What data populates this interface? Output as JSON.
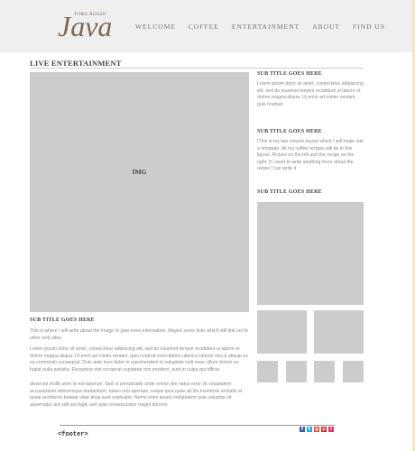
{
  "logo": {
    "tagline": "TORO ROSSO",
    "wordmark": "Java"
  },
  "nav": [
    "WELCOME",
    "COFFEE",
    "ENTERTAINMENT",
    "ABOUT",
    "FIND US"
  ],
  "page_title": "LIVE ENTERTAINMENT",
  "main_image_label": "IMG",
  "main_section": {
    "subtitle": "SUB TITLE GOES HERE",
    "intro": "This is where I will write about the image or give more information. Maybe some links which will link out to other web sites.",
    "para1": "Lorem ipsum dolor sit amet, consectetur adipiscing elit, sed do eiusmod tempor incididunt ut labore et dolore magna aliqua. Ut enim ad minim veniam, quis nostrud exercitation ullamco laboris nisi ut aliquip ex ea commodo consequat. Duis aute irure dolor in reprehenderit in voluptate velit esse cillum dolore eu fugiat nulla pariatur. Excepteur sint occaecat cupidatat non proident, sunt in culpa qui officia",
    "para2": "deserunt mollit anim id est laborum. Sed ut perspiciatis unde omnis iste natus error sit voluptatem accusantium doloremque laudantium, totam rem aperiam, eaque ipsa quae ab illo inventore veritatis et quasi architecto beatae vitae dicta sunt explicabo. Nemo enim ipsam voluptatem quia voluptas sit aspernatur aut odit aut fugit, sed quia consequuntur magni dolores"
  },
  "sidebar": {
    "block1": {
      "subtitle": "SUB TITLE GOES HERE",
      "text": "Lorem ipsum dolor sit amet, consectetur adipisicing elit, sed do eiusmod tempor incididunt ut labore et dolore magna aliqua. Ut enim ad minim veniam, quis nostrud"
    },
    "block2": {
      "subtitle": "SUB TITLE GOES HERE",
      "text": "IThis is my two column layout which I will make into a template. All my coffee recipes will be in this layout. Picture on the left and the recipe on the right. If I want to write anything more about the recipe I can write it"
    },
    "block3": {
      "subtitle": "SUB TITLE GOES HERE"
    }
  },
  "footer": {
    "label": "<footer>",
    "social": [
      {
        "name": "facebook-icon",
        "glyph": "f",
        "color": "#3b5998"
      },
      {
        "name": "twitter-icon",
        "glyph": "t",
        "color": "#2aa9e0"
      },
      {
        "name": "google-plus-icon",
        "glyph": "g",
        "color": "#dd4b39"
      },
      {
        "name": "pinterest-icon",
        "glyph": "p",
        "color": "#cb2027"
      },
      {
        "name": "instagram-icon",
        "glyph": "i",
        "color": "#e1306c"
      }
    ]
  }
}
